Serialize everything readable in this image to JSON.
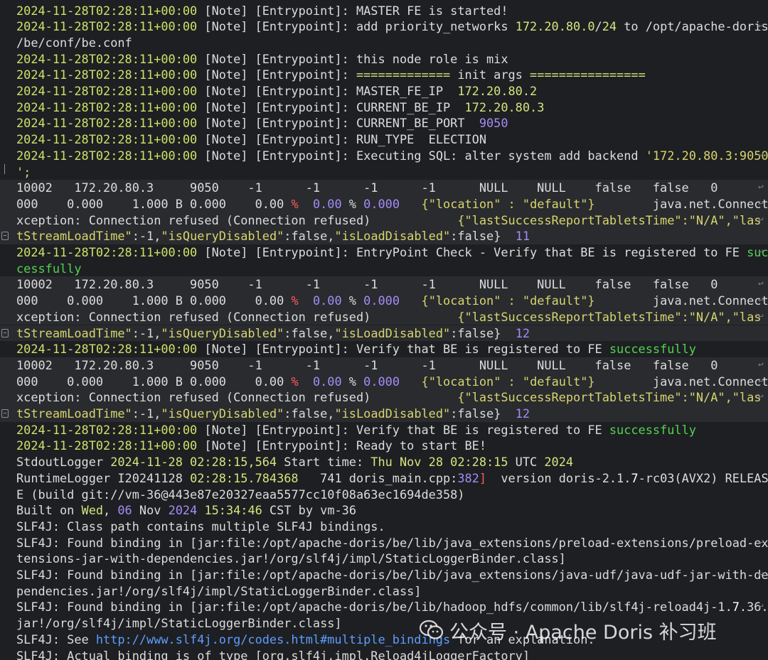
{
  "watermark": {
    "text": "公众号 · Apache Doris 补习班"
  },
  "lines": [
    {
      "segs": [
        [
          "g",
          "2024-11-28T02:28:11+00:00"
        ],
        [
          "",
          "[Note] [Entrypoint]: MASTER FE is started!"
        ]
      ]
    },
    {
      "segs": [
        [
          "g",
          "2024-11-28T02:28:11+00:00"
        ],
        [
          "",
          "[Note] [Entrypoint]: add priority_networks "
        ],
        [
          "y",
          "172.20.80.0"
        ],
        [
          "",
          "/"
        ],
        [
          "y",
          "24"
        ],
        [
          "",
          " to /opt/apache-doris"
        ]
      ],
      "wrap": true
    },
    {
      "segs": [
        [
          "",
          "/be/conf/be.conf"
        ]
      ]
    },
    {
      "segs": [
        [
          "g",
          "2024-11-28T02:28:11+00:00"
        ],
        [
          "",
          "[Note] [Entrypoint]: this node role is mix"
        ]
      ]
    },
    {
      "segs": [
        [
          "g",
          "2024-11-28T02:28:11+00:00"
        ],
        [
          "",
          "[Note] [Entrypoint]: "
        ],
        [
          "y",
          "============="
        ],
        [
          "",
          " init args "
        ],
        [
          "y",
          "================"
        ]
      ]
    },
    {
      "segs": [
        [
          "g",
          "2024-11-28T02:28:11+00:00"
        ],
        [
          "",
          "[Note] [Entrypoint]: MASTER_FE_IP  "
        ],
        [
          "y",
          "172.20.80.2"
        ]
      ]
    },
    {
      "segs": [
        [
          "g",
          "2024-11-28T02:28:11+00:00"
        ],
        [
          "",
          "[Note] [Entrypoint]: CURRENT_BE_IP  "
        ],
        [
          "y",
          "172.20.80.3"
        ]
      ]
    },
    {
      "segs": [
        [
          "g",
          "2024-11-28T02:28:11+00:00"
        ],
        [
          "",
          "[Note] [Entrypoint]: CURRENT_BE_PORT  "
        ],
        [
          "p",
          "9050"
        ]
      ]
    },
    {
      "segs": [
        [
          "g",
          "2024-11-28T02:28:11+00:00"
        ],
        [
          "",
          "[Note] [Entrypoint]: RUN_TYPE  ELECTION"
        ]
      ]
    },
    {
      "segs": [
        [
          "g",
          "2024-11-28T02:28:11+00:00"
        ],
        [
          "",
          "[Note] [Entrypoint]: Executing SQL: alter system add backend "
        ],
        [
          "s",
          "'172.20.80.3:9050"
        ]
      ],
      "wrap": true
    },
    {
      "segs": [
        [
          "s",
          "';"
        ]
      ],
      "tick": true
    },
    {
      "segs": [
        [
          "",
          "10002   172.20.80.3     9050    -1      -1      -1      -1      NULL    NULL    false   false   0       0."
        ]
      ],
      "wrap": true,
      "hl": true
    },
    {
      "segs": [
        [
          "",
          "000    0.000    1.000 B 0.000    0.00 "
        ],
        [
          "r",
          "%"
        ],
        [
          "",
          "  "
        ],
        [
          "p",
          "0.00"
        ],
        [
          "",
          " % "
        ],
        [
          "p",
          "0.000"
        ],
        [
          "",
          "   "
        ],
        [
          "s",
          "{\"location\" : \"default\"}"
        ],
        [
          "",
          "        java.net.ConnectE"
        ]
      ],
      "wrap": true,
      "hl": true
    },
    {
      "segs": [
        [
          "",
          "xception: Connection refused (Connection refused)            "
        ],
        [
          "s",
          "{\"lastSuccessReportTabletsTime\":\"N/A\",\"las"
        ]
      ],
      "wrap": true,
      "hl": true
    },
    {
      "segs": [
        [
          "s",
          "tStreamLoadTime\""
        ],
        [
          "",
          ":-1,"
        ],
        [
          "s",
          "\"isQueryDisabled\""
        ],
        [
          "",
          ":false,"
        ],
        [
          "s",
          "\"isLoadDisabled\""
        ],
        [
          "",
          ":false}  "
        ],
        [
          "p",
          "11"
        ]
      ],
      "icon": true,
      "hl": true
    },
    {
      "segs": [
        [
          "g",
          "2024-11-28T02:28:11+00:00"
        ],
        [
          "",
          "[Note] [Entrypoint]: EntryPoint Check - Verify that BE is registered to FE "
        ],
        [
          "gr",
          "suc"
        ]
      ],
      "wrap": true
    },
    {
      "segs": [
        [
          "gr",
          "cessfully"
        ]
      ]
    },
    {
      "segs": [
        [
          "",
          "10002   172.20.80.3     9050    -1      -1      -1      -1      NULL    NULL    false   false   0       0."
        ]
      ],
      "wrap": true,
      "hl": true
    },
    {
      "segs": [
        [
          "",
          "000    0.000    1.000 B 0.000    0.00 "
        ],
        [
          "r",
          "%"
        ],
        [
          "",
          "  "
        ],
        [
          "p",
          "0.00"
        ],
        [
          "",
          " % "
        ],
        [
          "p",
          "0.000"
        ],
        [
          "",
          "   "
        ],
        [
          "s",
          "{\"location\" : \"default\"}"
        ],
        [
          "",
          "        java.net.ConnectE"
        ]
      ],
      "wrap": true,
      "hl": true
    },
    {
      "segs": [
        [
          "",
          "xception: Connection refused (Connection refused)            "
        ],
        [
          "s",
          "{\"lastSuccessReportTabletsTime\":\"N/A\",\"las"
        ]
      ],
      "wrap": true,
      "hl": true
    },
    {
      "segs": [
        [
          "s",
          "tStreamLoadTime\""
        ],
        [
          "",
          ":-1,"
        ],
        [
          "s",
          "\"isQueryDisabled\""
        ],
        [
          "",
          ":false,"
        ],
        [
          "s",
          "\"isLoadDisabled\""
        ],
        [
          "",
          ":false}  "
        ],
        [
          "p",
          "12"
        ]
      ],
      "icon": true,
      "hl": true
    },
    {
      "segs": [
        [
          "g",
          "2024-11-28T02:28:11+00:00"
        ],
        [
          "",
          "[Note] [Entrypoint]: Verify that BE is registered to FE "
        ],
        [
          "gr",
          "successfully"
        ]
      ]
    },
    {
      "segs": [
        [
          "",
          "10002   172.20.80.3     9050    -1      -1      -1      -1      NULL    NULL    false   false   0       0."
        ]
      ],
      "wrap": true,
      "hl": true
    },
    {
      "segs": [
        [
          "",
          "000    0.000    1.000 B 0.000    0.00 "
        ],
        [
          "r",
          "%"
        ],
        [
          "",
          "  "
        ],
        [
          "p",
          "0.00"
        ],
        [
          "",
          " % "
        ],
        [
          "p",
          "0.000"
        ],
        [
          "",
          "   "
        ],
        [
          "s",
          "{\"location\" : \"default\"}"
        ],
        [
          "",
          "        java.net.ConnectE"
        ]
      ],
      "wrap": true,
      "hl": true
    },
    {
      "segs": [
        [
          "",
          "xception: Connection refused (Connection refused)            "
        ],
        [
          "s",
          "{\"lastSuccessReportTabletsTime\":\"N/A\",\"las"
        ]
      ],
      "wrap": true,
      "hl": true
    },
    {
      "segs": [
        [
          "s",
          "tStreamLoadTime\""
        ],
        [
          "",
          ":-1,"
        ],
        [
          "s",
          "\"isQueryDisabled\""
        ],
        [
          "",
          ":false,"
        ],
        [
          "s",
          "\"isLoadDisabled\""
        ],
        [
          "",
          ":false}  "
        ],
        [
          "p",
          "12"
        ]
      ],
      "icon": true,
      "hl": true
    },
    {
      "segs": [
        [
          "g",
          "2024-11-28T02:28:11+00:00"
        ],
        [
          "",
          "[Note] [Entrypoint]: Verify that BE is registered to FE "
        ],
        [
          "gr",
          "successfully"
        ]
      ]
    },
    {
      "segs": [
        [
          "g",
          "2024-11-28T02:28:11+00:00"
        ],
        [
          "",
          "[Note] [Entrypoint]: Ready to start BE!"
        ]
      ]
    },
    {
      "segs": [
        [
          "",
          "StdoutLogger "
        ],
        [
          "y",
          "2024-11-28 02:28:15,564"
        ],
        [
          "",
          " Start time: "
        ],
        [
          "y",
          "Thu Nov 28 02:28:15"
        ],
        [
          "",
          " UTC "
        ],
        [
          "y",
          "2024"
        ]
      ]
    },
    {
      "segs": [
        [
          "",
          "RuntimeLogger I20241128 "
        ],
        [
          "y",
          "02:28:15.784368"
        ],
        [
          "",
          "   741 doris_main.cpp:"
        ],
        [
          "p",
          "382"
        ],
        [
          "r",
          "]"
        ],
        [
          "",
          "  version doris-2.1."
        ],
        [
          "w",
          "7"
        ],
        [
          "",
          "-rc03(AVX2) RELEAS"
        ]
      ]
    },
    {
      "segs": [
        [
          "",
          "E (build git://vm-36@443e87e20327eaa5577cc10f08a63ec1694de358)"
        ]
      ]
    },
    {
      "segs": [
        [
          "",
          "Built on "
        ],
        [
          "y",
          "Wed"
        ],
        [
          "",
          ", "
        ],
        [
          "p",
          "06"
        ],
        [
          "",
          " Nov "
        ],
        [
          "p",
          "2024"
        ],
        [
          "",
          ""
        ],
        [
          "y",
          " 15:34:46"
        ],
        [
          "",
          " CST by vm-36"
        ]
      ]
    },
    {
      "segs": [
        [
          "",
          "SLF4J: Class path contains multiple SLF4J bindings."
        ]
      ]
    },
    {
      "segs": [
        [
          "",
          "SLF4J: Found binding in [jar:file:/opt/apache-doris/be/lib/java_extensions/preload-extensions/preload-ex"
        ]
      ],
      "wrap": true
    },
    {
      "segs": [
        [
          "",
          "tensions-jar-with-dependencies.jar!/org/slf4j/impl/StaticLoggerBinder.class]"
        ]
      ]
    },
    {
      "segs": [
        [
          "",
          "SLF4J: Found binding in [jar:file:/opt/apache-doris/be/lib/java_extensions/java-udf/java-udf-jar-with-de"
        ]
      ],
      "wrap": true
    },
    {
      "segs": [
        [
          "",
          "pendencies.jar!/org/slf4j/impl/StaticLoggerBinder.class]"
        ]
      ]
    },
    {
      "segs": [
        [
          "",
          "SLF4J: Found binding in [jar:file:/opt/apache-doris/be/lib/hadoop_hdfs/common/lib/slf4j-reload4j-1."
        ],
        [
          "w",
          "7"
        ],
        [
          "",
          ".36."
        ]
      ],
      "wrap": true
    },
    {
      "segs": [
        [
          "",
          "jar!/org/slf4j/impl/StaticLoggerBinder.class]"
        ]
      ]
    },
    {
      "segs": [
        [
          "",
          "SLF4J: See "
        ],
        [
          "l",
          "http://www.slf4j.org/codes.html#multiple_bindings"
        ],
        [
          "",
          " for an explanation."
        ]
      ]
    },
    {
      "segs": [
        [
          "",
          "SLF4J: Actual binding is of type [org.slf4j.impl.Reload4jLoggerFactory]"
        ]
      ]
    }
  ]
}
